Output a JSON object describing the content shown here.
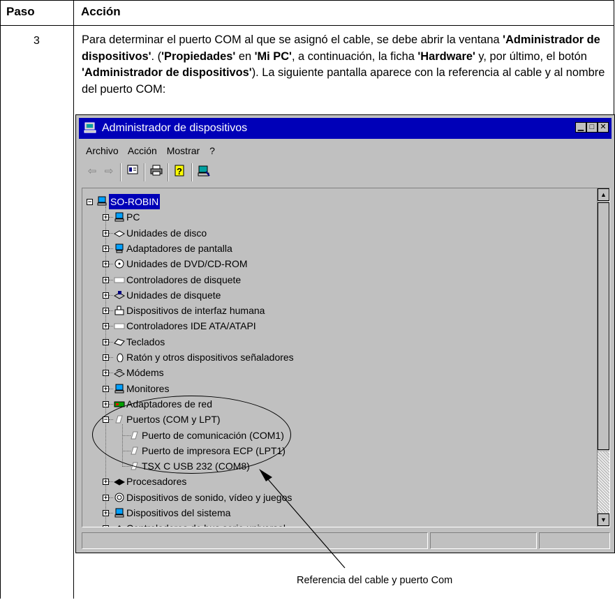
{
  "table": {
    "header_step": "Paso",
    "header_action": "Acción",
    "step_number": "3"
  },
  "paragraph": {
    "t1": "Para determinar el puerto COM al que se asignó el cable, se debe abrir la ventana ",
    "b1": "'Administrador de dispositivos'",
    "t2": ". (",
    "b2": "'Propiedades'",
    "t3": " en ",
    "b3": "'Mi PC'",
    "t4": ", a continuación, la ficha ",
    "b4": "'Hardware'",
    "t5": " y, por último, el botón ",
    "b5": "'Administrador de dispositivos'",
    "t6": "). La siguiente pantalla aparece con la referencia al cable y al nombre del puerto COM:"
  },
  "window": {
    "title": "Administrador de dispositivos",
    "menu": [
      "Archivo",
      "Acción",
      "Mostrar",
      "?"
    ],
    "root_node": "SO-ROBIN",
    "tree": [
      {
        "label": "PC",
        "icon": "computer-icon",
        "expander": "+"
      },
      {
        "label": "Unidades de disco",
        "icon": "disk-drive-icon",
        "expander": "+"
      },
      {
        "label": "Adaptadores de pantalla",
        "icon": "display-adapter-icon",
        "expander": "+"
      },
      {
        "label": "Unidades de DVD/CD-ROM",
        "icon": "cdrom-icon",
        "expander": "+"
      },
      {
        "label": "Controladores de disquete",
        "icon": "floppy-controller-icon",
        "expander": "+"
      },
      {
        "label": "Unidades de disquete",
        "icon": "floppy-drive-icon",
        "expander": "+"
      },
      {
        "label": "Dispositivos de interfaz humana",
        "icon": "hid-icon",
        "expander": "+"
      },
      {
        "label": "Controladores IDE ATA/ATAPI",
        "icon": "ide-controller-icon",
        "expander": "+"
      },
      {
        "label": "Teclados",
        "icon": "keyboard-icon",
        "expander": "+"
      },
      {
        "label": "Ratón y otros dispositivos señaladores",
        "icon": "mouse-icon",
        "expander": "+"
      },
      {
        "label": "Módems",
        "icon": "modem-icon",
        "expander": "+"
      },
      {
        "label": "Monitores",
        "icon": "monitor-icon",
        "expander": "+"
      },
      {
        "label": "Adaptadores de red",
        "icon": "network-adapter-icon",
        "expander": "+"
      },
      {
        "label": "Puertos (COM y LPT)",
        "icon": "port-icon",
        "expander": "-"
      },
      {
        "label": "Puerto de comunicación (COM1)",
        "icon": "port-icon",
        "expander": ""
      },
      {
        "label": "Puerto de impresora ECP (LPT1)",
        "icon": "port-icon",
        "expander": ""
      },
      {
        "label": "TSX C USB 232 (COM8)",
        "icon": "port-icon",
        "expander": ""
      },
      {
        "label": "Procesadores",
        "icon": "processor-icon",
        "expander": "+"
      },
      {
        "label": "Dispositivos de sonido, vídeo y juegos",
        "icon": "sound-icon",
        "expander": "+"
      },
      {
        "label": "Dispositivos del sistema",
        "icon": "system-device-icon",
        "expander": "+"
      },
      {
        "label": "Controladores de bus serie universal",
        "icon": "usb-icon",
        "expander": "+"
      }
    ]
  },
  "caption": "Referencia del cable y puerto Com",
  "colors": {
    "titlebar": "#0000b8",
    "window_bg": "#c0c0c0",
    "selection": "#0000b8"
  }
}
